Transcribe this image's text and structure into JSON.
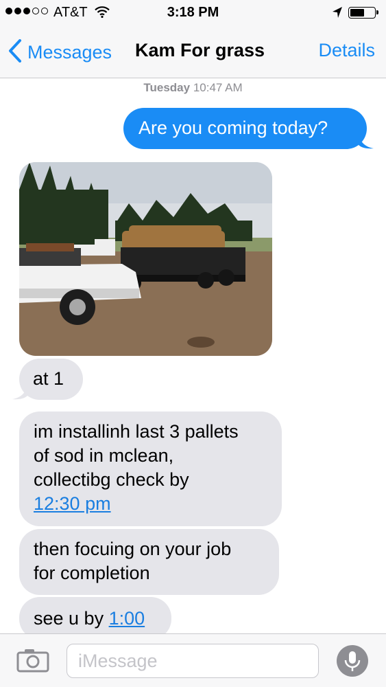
{
  "status_bar": {
    "carrier": "AT&T",
    "time": "3:18 PM",
    "signal_bars_filled": 3,
    "signal_bars_total": 5,
    "battery_level": 0.5
  },
  "nav": {
    "back_label": "Messages",
    "title": "Kam For grass",
    "details_label": "Details"
  },
  "timestamp": {
    "day": "Tuesday",
    "time": "10:47 AM"
  },
  "messages": [
    {
      "direction": "outgoing",
      "text": "Are you coming today?"
    },
    {
      "direction": "incoming",
      "type": "image",
      "description": "photo"
    },
    {
      "direction": "incoming",
      "text": "at 1"
    },
    {
      "direction": "incoming",
      "lines": [
        "im installinh last 3 pallets",
        "of sod in mclean,",
        "collectibg check by"
      ],
      "link": "12:30 pm"
    },
    {
      "direction": "incoming",
      "lines": [
        "then focuing on your job",
        "for completion"
      ]
    },
    {
      "direction": "incoming",
      "prefix": "see u by ",
      "link": "1:00"
    }
  ],
  "input": {
    "placeholder": "iMessage"
  },
  "colors": {
    "accent": "#1a8cf5",
    "incoming_bubble": "#e5e5ea",
    "bar_background": "#f7f7f8"
  },
  "icons": [
    "chevron-left-icon",
    "wifi-icon",
    "location-arrow-icon",
    "battery-icon",
    "camera-icon",
    "microphone-icon"
  ]
}
